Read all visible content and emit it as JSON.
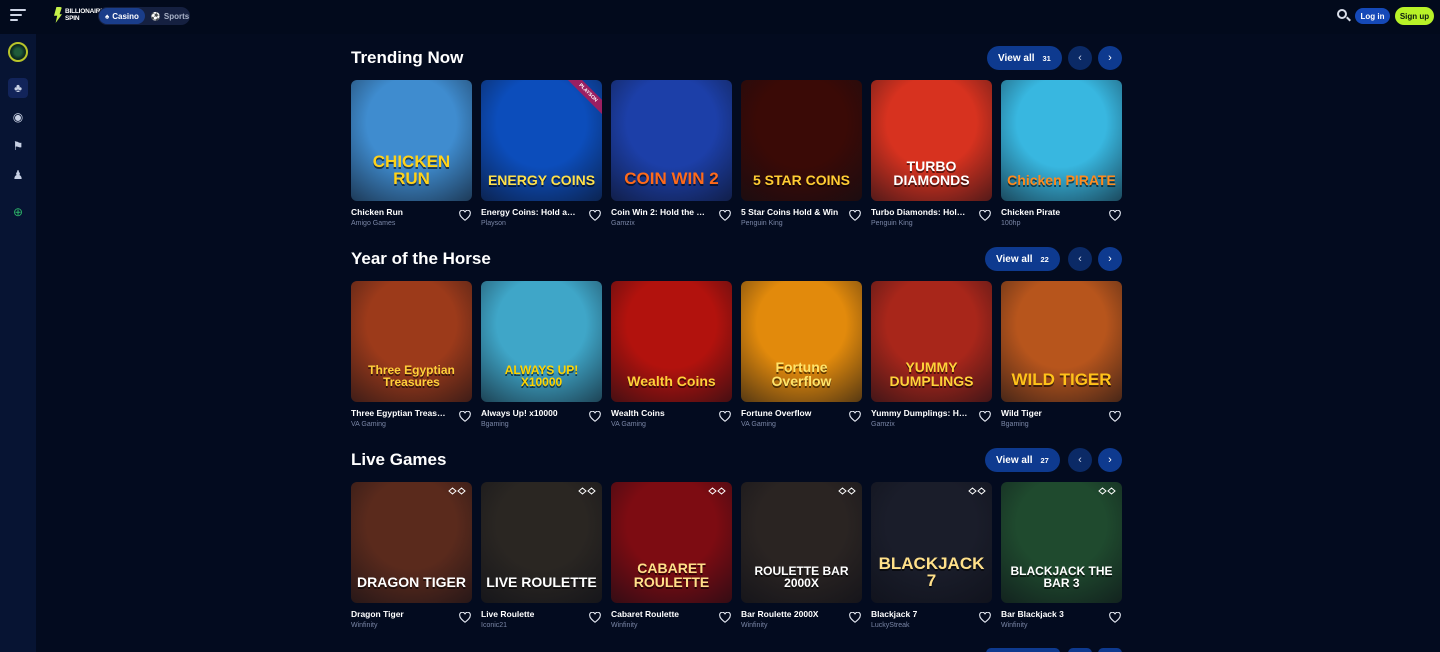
{
  "header": {
    "logo_text": "BILLIONAIRE SPIN",
    "modes": [
      {
        "label": "Casino",
        "icon": "casino-icon",
        "active": true
      },
      {
        "label": "Sports",
        "icon": "sports-icon",
        "active": false
      }
    ],
    "login_label": "Log in",
    "signup_label": "Sign up"
  },
  "sidebar": {
    "icons": [
      "bonus-badge-icon",
      "casino-chip-icon",
      "live-broadcast-icon",
      "sports-flag-icon",
      "poker-player-icon",
      "globe-icon"
    ]
  },
  "sections": [
    {
      "title": "Trending Now",
      "view_all_label": "View all",
      "count": "31",
      "games": [
        {
          "title": "Chicken Run",
          "provider": "Amigo Games",
          "art": "CHICKEN RUN",
          "bg": "#3f8ccf",
          "fg": "#ffd21a"
        },
        {
          "title": "Energy Coins: Hold and ...",
          "provider": "Playson",
          "art": "ENERGY COINS",
          "bg": "#0c4dbb",
          "fg": "#ffe04a",
          "tag": "PLAYSON"
        },
        {
          "title": "Coin Win 2: Hold the Spin",
          "provider": "Gamzix",
          "art": "COIN WIN 2",
          "bg": "#1c3fa8",
          "fg": "#ff6a1a"
        },
        {
          "title": "5 Star Coins Hold & Win",
          "provider": "Penguin King",
          "art": "5 STAR COINS",
          "bg": "#3a0a06",
          "fg": "#ffcc33"
        },
        {
          "title": "Turbo Diamonds: Hold & ...",
          "provider": "Penguin King",
          "art": "TURBO DIAMONDS",
          "bg": "#d7321f",
          "fg": "#ffffff"
        },
        {
          "title": "Chicken Pirate",
          "provider": "100hp",
          "art": "Chicken PIRATE",
          "bg": "#38b7e0",
          "fg": "#ff8a1c"
        }
      ]
    },
    {
      "title": "Year of the Horse",
      "view_all_label": "View all",
      "count": "22",
      "games": [
        {
          "title": "Three Egyptian Treasures",
          "provider": "VA Gaming",
          "art": "Three Egyptian Treasures",
          "bg": "#9c3a1a",
          "fg": "#ffcf3a"
        },
        {
          "title": "Always Up! x10000",
          "provider": "Bgaming",
          "art": "ALWAYS UP! X10000",
          "bg": "#3fa6c8",
          "fg": "#ffd400"
        },
        {
          "title": "Wealth Coins",
          "provider": "VA Gaming",
          "art": "Wealth Coins",
          "bg": "#b2120d",
          "fg": "#ffd13a"
        },
        {
          "title": "Fortune Overflow",
          "provider": "VA Gaming",
          "art": "Fortune Overflow",
          "bg": "#e28a0c",
          "fg": "#ffe46a"
        },
        {
          "title": "Yummy Dumplings: Hol...",
          "provider": "Gamzix",
          "art": "YUMMY DUMPLINGS",
          "bg": "#a8261a",
          "fg": "#ffd23a"
        },
        {
          "title": "Wild Tiger",
          "provider": "Bgaming",
          "art": "WILD TIGER",
          "bg": "#b7551c",
          "fg": "#ffc21a"
        }
      ]
    },
    {
      "title": "Live Games",
      "view_all_label": "View all",
      "count": "27",
      "games": [
        {
          "title": "Dragon Tiger",
          "provider": "Winfinity",
          "art": "DRAGON TIGER",
          "bg": "#5a2a1c",
          "fg": "#ffffff"
        },
        {
          "title": "Live Roulette",
          "provider": "Iconic21",
          "art": "LIVE ROULETTE",
          "bg": "#2a2622",
          "fg": "#ffffff"
        },
        {
          "title": "Cabaret Roulette",
          "provider": "Winfinity",
          "art": "CABARET ROULETTE",
          "bg": "#7d0c12",
          "fg": "#ffe08a"
        },
        {
          "title": "Bar Roulette 2000X",
          "provider": "Winfinity",
          "art": "ROULETTE BAR 2000X",
          "bg": "#2a2422",
          "fg": "#ffffff"
        },
        {
          "title": "Blackjack 7",
          "provider": "LuckyStreak",
          "art": "BLACKJACK 7",
          "bg": "#1a1d2a",
          "fg": "#ffe08a"
        },
        {
          "title": "Bar Blackjack 3",
          "provider": "Winfinity",
          "art": "BLACKJACK THE BAR 3",
          "bg": "#1f4a2e",
          "fg": "#ffffff"
        }
      ]
    }
  ]
}
